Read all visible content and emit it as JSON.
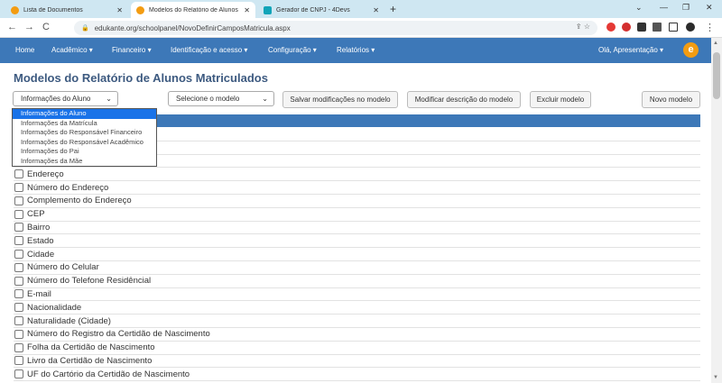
{
  "browser": {
    "tabs": [
      {
        "title": "Lista de Documentos",
        "favicon": "orange-e-icon"
      },
      {
        "title": "Modelos do Relatório de Alunos",
        "favicon": "orange-e-icon",
        "active": true
      },
      {
        "title": "Gerador de CNPJ - 4Devs",
        "favicon": "4devs-icon"
      }
    ],
    "url": "edukante.org/schoolpanel/NovoDefinirCamposMatricula.aspx",
    "new_tab": "+",
    "nav_back": "←",
    "nav_forward": "→",
    "nav_reload": "C",
    "window_controls": [
      "⌄",
      "—",
      "❐",
      "✕"
    ]
  },
  "app_nav": {
    "items": [
      "Home",
      "Acadêmico ▾",
      "Financeiro ▾",
      "Identificação e acesso ▾",
      "Configuração ▾",
      "Relatórios ▾"
    ],
    "greeting": "Olá, Apresentação ▾",
    "logo_letter": "e",
    "accent": "#3d78b8",
    "logo_color": "#f39c12"
  },
  "page": {
    "title": "Modelos do Relatório de Alunos Matriculados",
    "category_select": "Informações do Aluno",
    "model_select": "Selecione o modelo",
    "buttons": {
      "save": "Salvar modificações no modelo",
      "modify": "Modificar descrição do modelo",
      "delete": "Excluir modelo",
      "new": "Novo modelo"
    },
    "dropdown_options": [
      "Informações do Aluno",
      "Informações da Matrícula",
      "Informações do Responsável Financeiro",
      "Informações do Responsável Acadêmico",
      "Informações do Pai",
      "Informações da Mãe"
    ],
    "fields": [
      "",
      "",
      "",
      "Endereço",
      "Número do Endereço",
      "Complemento do Endereço",
      "CEP",
      "Bairro",
      "Estado",
      "Cidade",
      "Número do Celular",
      "Número do Telefone Residêncial",
      "E-mail",
      "Nacionalidade",
      "Naturalidade (Cidade)",
      "Número do Registro da Certidão de Nascimento",
      "Folha da Certidão de Nascimento",
      "Livro da Certidão de Nascimento",
      "UF do Cartório da Certidão de Nascimento"
    ]
  }
}
